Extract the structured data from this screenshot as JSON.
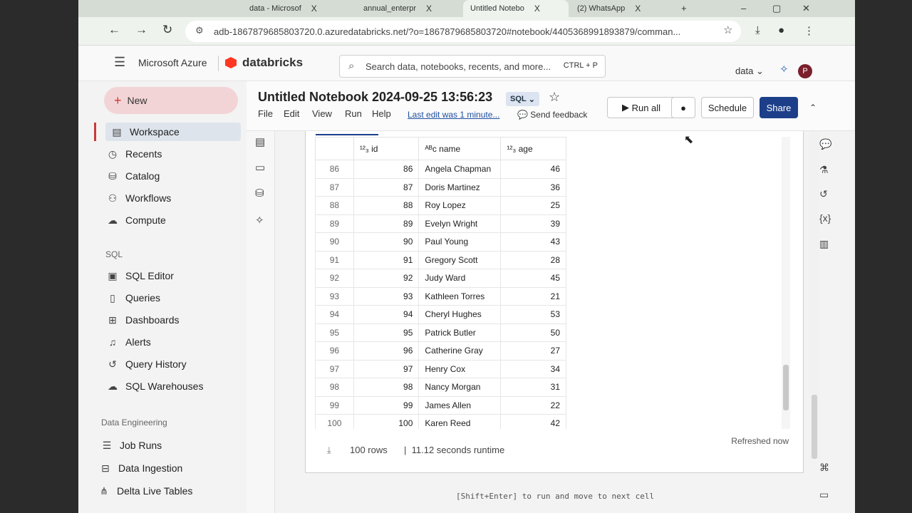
{
  "browser": {
    "tabs": [
      {
        "label": "data - Microsof",
        "close": "X"
      },
      {
        "label": "annual_enterpr",
        "close": "X"
      },
      {
        "label": "Untitled Notebo",
        "close": "X"
      },
      {
        "label": "(2) WhatsApp",
        "close": "X"
      }
    ],
    "new_tab": "+",
    "url": "adb-1867879685803720.0.azuredatabricks.net/?o=1867879685803720#notebook/4405368991893879/comman..."
  },
  "header": {
    "brand": "Microsoft Azure",
    "product": "databricks",
    "search_placeholder": "Search data, notebooks, recents, and more...",
    "search_shortcut": "CTRL + P",
    "workspace": "data",
    "avatar": "P"
  },
  "sidebar": {
    "new_label": "New",
    "items": [
      {
        "label": "Workspace",
        "icon": "folder-icon"
      },
      {
        "label": "Recents",
        "icon": "clock-icon"
      },
      {
        "label": "Catalog",
        "icon": "catalog-icon"
      },
      {
        "label": "Workflows",
        "icon": "workflows-icon"
      },
      {
        "label": "Compute",
        "icon": "cloud-icon"
      }
    ],
    "sql_section": "SQL",
    "sql_items": [
      {
        "label": "SQL Editor",
        "icon": "editor-icon"
      },
      {
        "label": "Queries",
        "icon": "queries-icon"
      },
      {
        "label": "Dashboards",
        "icon": "dashboard-icon"
      },
      {
        "label": "Alerts",
        "icon": "bell-icon"
      },
      {
        "label": "Query History",
        "icon": "history-icon"
      },
      {
        "label": "SQL Warehouses",
        "icon": "warehouse-icon"
      }
    ],
    "de_section": "Data Engineering",
    "de_items": [
      {
        "label": "Job Runs",
        "icon": "list-icon"
      },
      {
        "label": "Data Ingestion",
        "icon": "ingestion-icon"
      },
      {
        "label": "Delta Live Tables",
        "icon": "delta-icon"
      }
    ]
  },
  "notebook": {
    "title": "Untitled Notebook 2024-09-25 13:56:23",
    "language": "SQL",
    "menu": [
      "File",
      "Edit",
      "View",
      "Run",
      "Help"
    ],
    "last_edit": "Last edit was 1 minute...",
    "feedback": "Send feedback",
    "run_all": "Run all",
    "schedule": "Schedule",
    "share": "Share"
  },
  "result": {
    "columns": [
      "id",
      "name",
      "age"
    ],
    "rows": [
      [
        86,
        86,
        "Angela Chapman",
        46
      ],
      [
        87,
        87,
        "Doris Martinez",
        36
      ],
      [
        88,
        88,
        "Roy Lopez",
        25
      ],
      [
        89,
        89,
        "Evelyn Wright",
        39
      ],
      [
        90,
        90,
        "Paul Young",
        43
      ],
      [
        91,
        91,
        "Gregory Scott",
        28
      ],
      [
        92,
        92,
        "Judy Ward",
        45
      ],
      [
        93,
        93,
        "Kathleen Torres",
        21
      ],
      [
        94,
        94,
        "Cheryl Hughes",
        53
      ],
      [
        95,
        95,
        "Patrick Butler",
        50
      ],
      [
        96,
        96,
        "Catherine Gray",
        27
      ],
      [
        97,
        97,
        "Henry Cox",
        34
      ],
      [
        98,
        98,
        "Nancy Morgan",
        31
      ],
      [
        99,
        99,
        "James Allen",
        22
      ],
      [
        100,
        100,
        "Karen Reed",
        42
      ]
    ],
    "row_count": "100 rows",
    "runtime": "11.12 seconds runtime",
    "refreshed": "Refreshed now"
  },
  "hint": "[Shift+Enter] to run and move to next cell"
}
